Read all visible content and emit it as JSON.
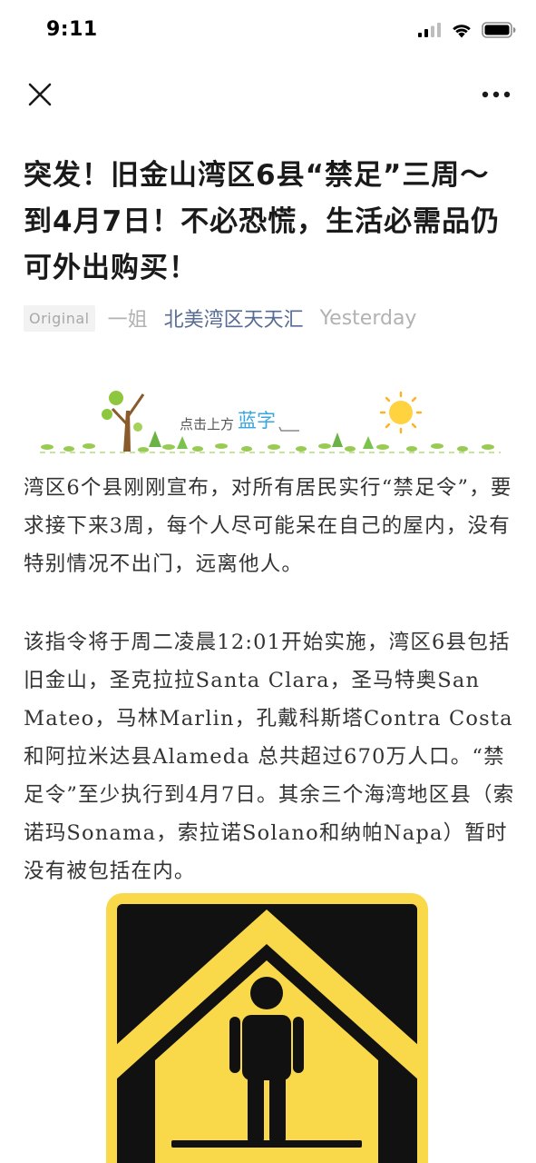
{
  "status_bar": {
    "time": "9:11"
  },
  "article": {
    "title": "突发！旧金山湾区6县“禁足”三周～到4月7日！不必恐慌，生活必需品仍可外出购买！",
    "badge": "Original",
    "author": "一姐",
    "account": "北美湾区天天汇",
    "date": "Yesterday",
    "banner_text": "点击上方",
    "banner_highlight": "蓝字",
    "paragraphs": [
      "湾区6个县刚刚宣布，对所有居民实行“禁足令”，要求接下来3周，每个人尽可能呆在自己的屋内，没有特别情况不出门，远离他人。",
      "该指令将于周二凌晨12:01开始实施，湾区6县包括旧金山，圣克拉拉Santa Clara，圣马特奥San Mateo，马林Marlin，孔戴科斯塔Contra Costa和阿拉米达县Alameda 总共超过670万人口。“禁足令”至少执行到4月7日。其余三个海湾地区县（索诺玛Sonama，索拉诺Solano和纳帕Napa）暂时没有被包括在内。"
    ]
  },
  "colors": {
    "link": "#576b95",
    "sign_yellow": "#f9d84a",
    "sign_black": "#111111"
  }
}
